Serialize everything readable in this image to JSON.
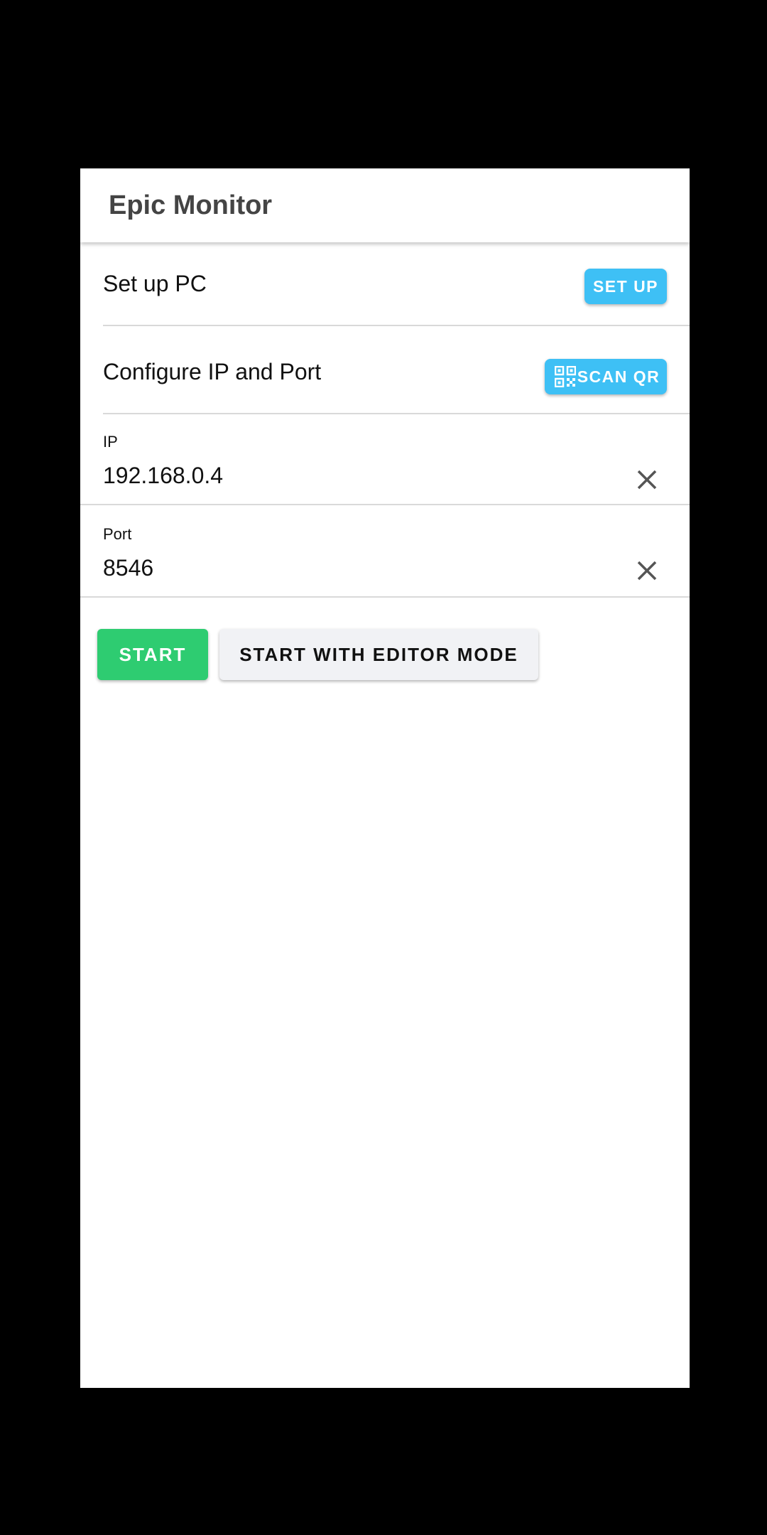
{
  "appbar": {
    "title": "Epic Monitor"
  },
  "setup": {
    "label": "Set up PC",
    "button_label": "SET UP"
  },
  "configure": {
    "label": "Configure IP and Port",
    "button_label": "SCAN QR",
    "button_icon": "qr-code-icon"
  },
  "ip": {
    "label": "IP",
    "value": "192.168.0.4",
    "clear_icon": "close-icon"
  },
  "port": {
    "label": "Port",
    "value": "8546",
    "clear_icon": "close-icon"
  },
  "actions": {
    "start_label": "START",
    "editor_label": "START WITH EDITOR MODE"
  },
  "colors": {
    "accent": "#3ec0f5",
    "start_green": "#2ecc71",
    "secondary_button": "#f1f2f5",
    "title_text": "#444444"
  }
}
